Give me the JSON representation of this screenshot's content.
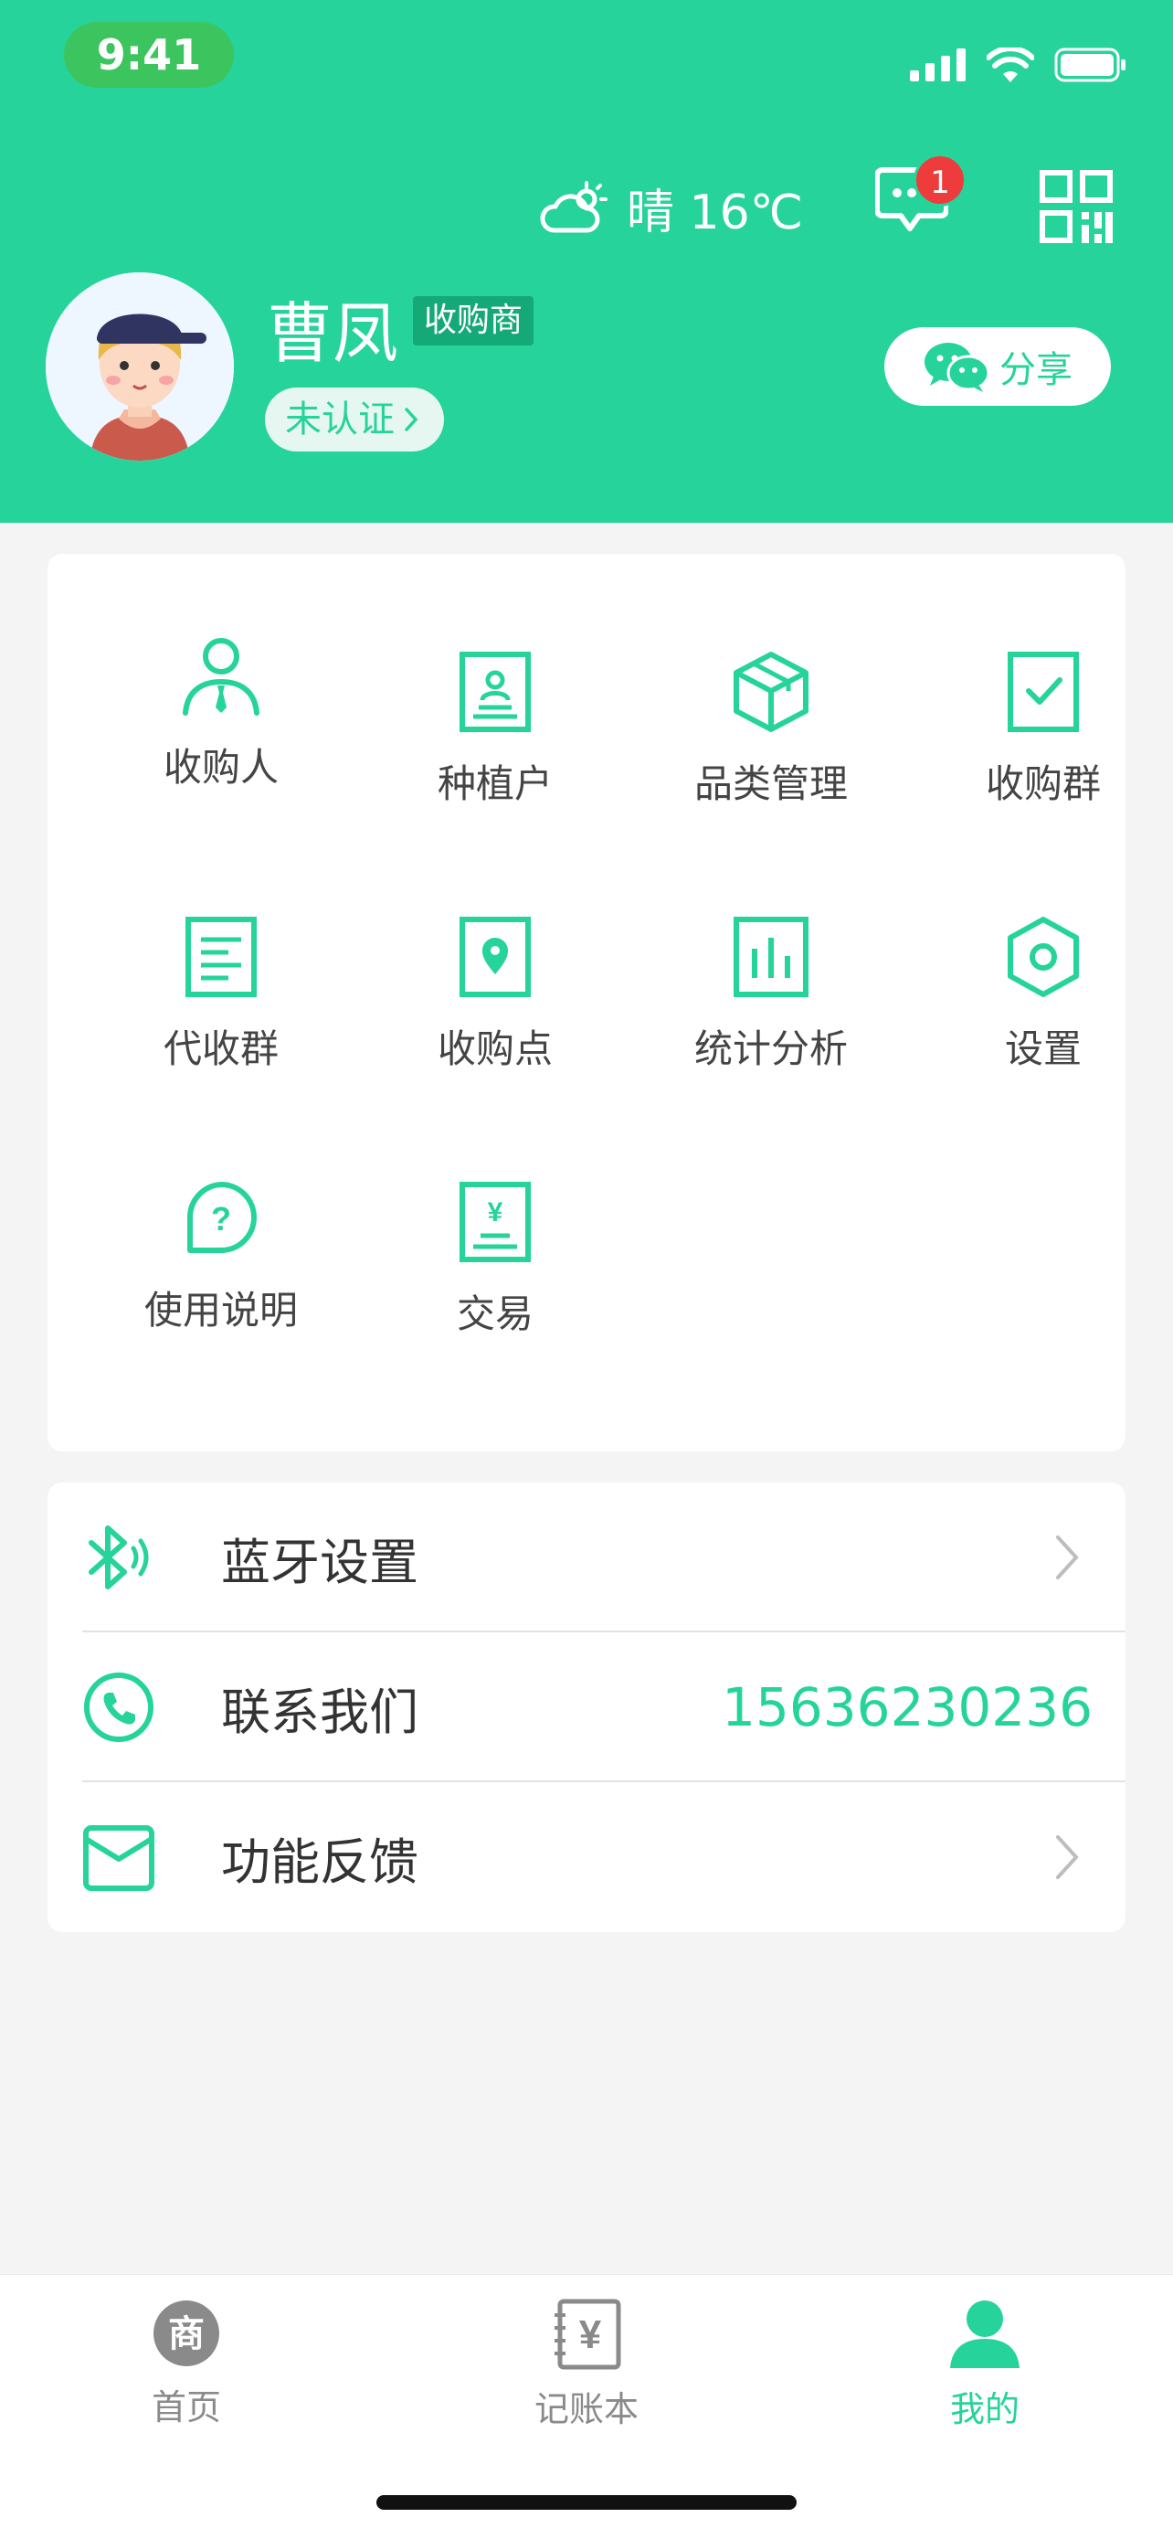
{
  "status": {
    "time": "9:41"
  },
  "header": {
    "weather_text": "晴 16℃",
    "message_badge": "1",
    "user_name": "曹凤",
    "role_tag": "收购商",
    "verify_label": "未认证",
    "share_label": "分享"
  },
  "grid": {
    "items": [
      {
        "label": "收购人",
        "icon": "buyer-person-icon"
      },
      {
        "label": "种植户",
        "icon": "grower-icon"
      },
      {
        "label": "品类管理",
        "icon": "box-icon"
      },
      {
        "label": "收购群",
        "icon": "checkbox-icon"
      },
      {
        "label": "代收群",
        "icon": "document-icon"
      },
      {
        "label": "收购点",
        "icon": "location-pin-icon"
      },
      {
        "label": "统计分析",
        "icon": "bar-chart-icon"
      },
      {
        "label": "设置",
        "icon": "hexagon-settings-icon"
      },
      {
        "label": "使用说明",
        "icon": "help-bubble-icon"
      },
      {
        "label": "交易",
        "icon": "yen-ticket-icon"
      }
    ]
  },
  "list": {
    "bluetooth_label": "蓝牙设置",
    "contact_label": "联系我们",
    "contact_phone": "15636230236",
    "feedback_label": "功能反馈"
  },
  "tabbar": {
    "items": [
      {
        "label": "首页",
        "icon": "shop-icon"
      },
      {
        "label": "记账本",
        "icon": "ledger-icon"
      },
      {
        "label": "我的",
        "icon": "user-icon"
      }
    ],
    "active_index": 2
  },
  "colors": {
    "primary": "#26d39a",
    "badge": "#ee3b3b",
    "background": "#f4f4f4"
  }
}
